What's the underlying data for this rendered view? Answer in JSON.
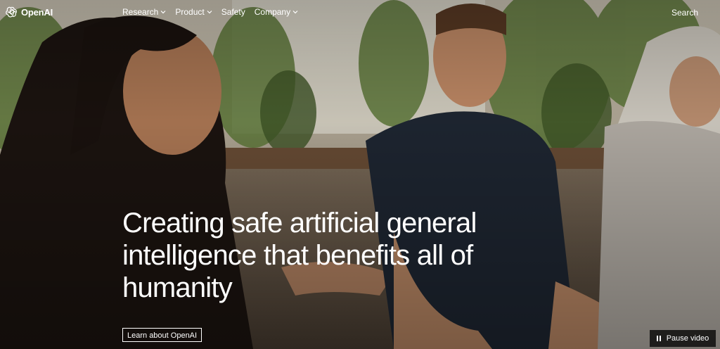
{
  "brand": {
    "name": "OpenAI",
    "logo_icon": "openai-knot-icon"
  },
  "nav": {
    "items": [
      {
        "label": "Research",
        "has_dropdown": true
      },
      {
        "label": "Product",
        "has_dropdown": true
      },
      {
        "label": "Safety",
        "has_dropdown": false
      },
      {
        "label": "Company",
        "has_dropdown": true
      }
    ],
    "search_label": "Search"
  },
  "hero": {
    "headline": "Creating safe artificial general intelligence that benefits all of humanity",
    "cta_label": "Learn about OpenAI",
    "pause_label": "Pause video",
    "pause_icon": "pause-icon"
  },
  "colors": {
    "text": "#ffffff",
    "pause_bg": "#000000"
  }
}
